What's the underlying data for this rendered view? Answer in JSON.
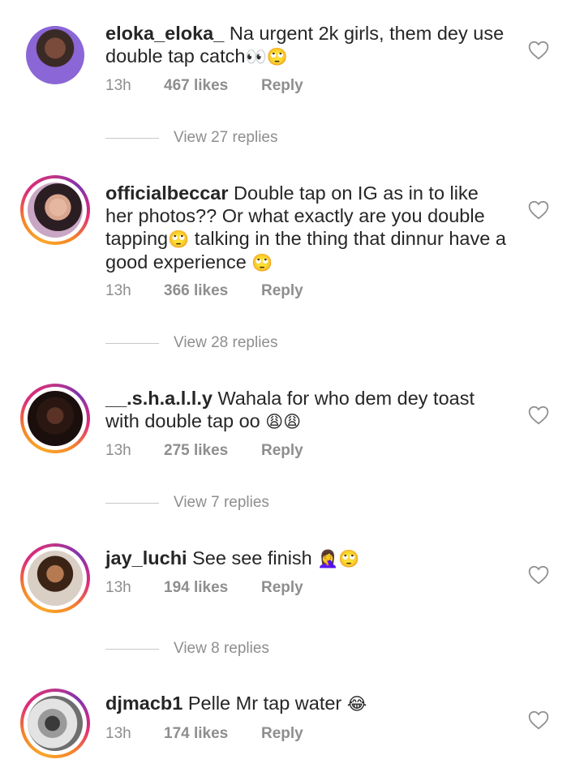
{
  "comments": [
    {
      "username": "eloka_eloka_",
      "text": "Na urgent 2k girls, them dey use double tap catch",
      "emoji": "👀🙄",
      "time": "13h",
      "likes": "467 likes",
      "reply": "Reply",
      "view_replies": "View 27 replies"
    },
    {
      "username": "officialbeccar",
      "text": "Double tap on IG as in to like her photos?? Or what exactly are you double tapping",
      "emoji": "🙄",
      "text2": " talking in the thing that dinnur have a good experience ",
      "emoji2": "🙄",
      "time": "13h",
      "likes": "366 likes",
      "reply": "Reply",
      "view_replies": "View 28 replies"
    },
    {
      "username": "__.s.h.a.l.l.y",
      "text": "Wahala for who dem dey toast with double tap oo ",
      "emoji": "😩😩",
      "time": "13h",
      "likes": "275 likes",
      "reply": "Reply",
      "view_replies": "View 7 replies"
    },
    {
      "username": "jay_luchi",
      "text": "See see finish ",
      "emoji": "🤦‍♀️🙄",
      "time": "13h",
      "likes": "194 likes",
      "reply": "Reply",
      "view_replies": "View 8 replies"
    },
    {
      "username": "djmacb1",
      "text": "Pelle Mr tap water ",
      "emoji": "😂",
      "time": "13h",
      "likes": "174 likes",
      "reply": "Reply"
    }
  ],
  "colors": {
    "text": "#262626",
    "secondary": "#8e8e8e",
    "story_ring": "#dd2a7b"
  },
  "icons": {
    "like": "heart-outline-icon"
  }
}
